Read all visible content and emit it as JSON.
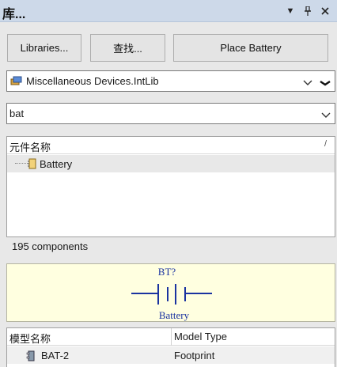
{
  "panel": {
    "title": "库...",
    "menu_icon": "dropdown-triangle-icon",
    "pin_icon": "pin-icon",
    "close_icon": "close-icon"
  },
  "toolbar": {
    "libraries_label": "Libraries...",
    "search_label": "查找...",
    "place_label": "Place Battery"
  },
  "library_select": {
    "value": "Miscellaneous Devices.IntLib",
    "icon": "library-icon"
  },
  "filter": {
    "value": "bat"
  },
  "components": {
    "column_header": "元件名称",
    "items": [
      {
        "name": "Battery",
        "icon": "component-icon"
      }
    ],
    "count_text": "195 components"
  },
  "preview": {
    "designator": "BT?",
    "comment": "Battery",
    "symbol_color": "#1a33a0"
  },
  "models": {
    "headers": [
      "模型名称",
      "Model Type"
    ],
    "rows": [
      {
        "name": "BAT-2",
        "type": "Footprint",
        "icon": "footprint-icon"
      }
    ]
  }
}
